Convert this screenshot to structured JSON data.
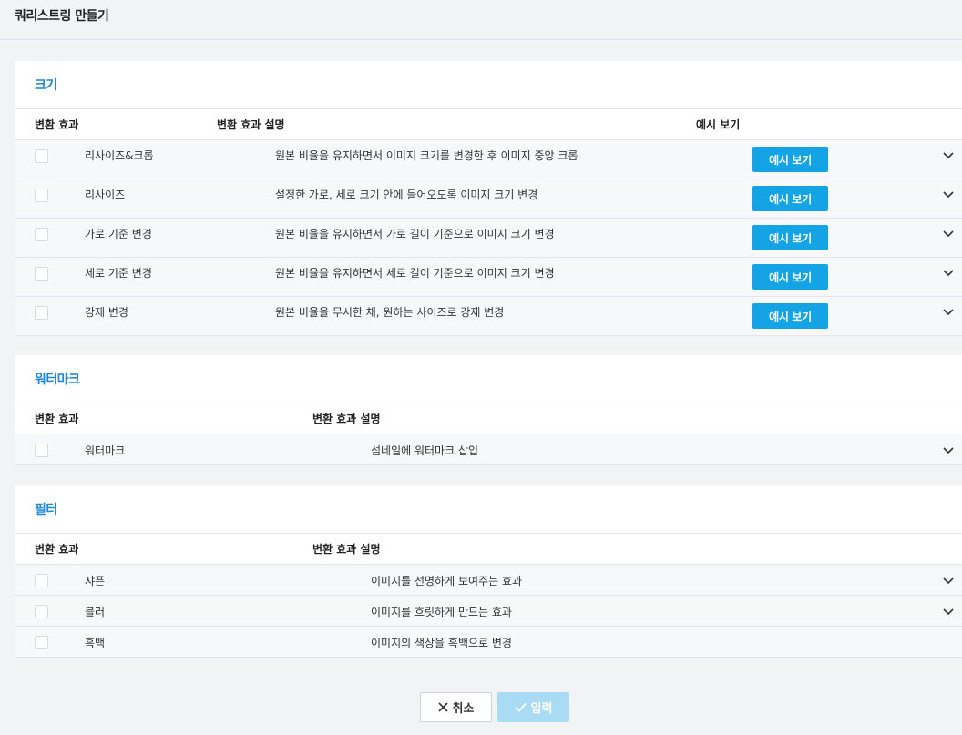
{
  "page": {
    "title": "쿼리스트링 만들기"
  },
  "size_section": {
    "title": "크기",
    "headers": {
      "effect": "변환 효과",
      "description": "변환 효과 설명",
      "preview": "예시 보기"
    },
    "rows": [
      {
        "name": "리사이즈&크롭",
        "description": "원본 비율을 유지하면서 이미지 크기를 변경한 후 이미지 중앙 크롭",
        "preview_label": "예시 보기"
      },
      {
        "name": "리사이즈",
        "description": "설정한 가로, 세로 크기 안에 들어오도록 이미지 크기 변경",
        "preview_label": "예시 보기"
      },
      {
        "name": "가로 기준 변경",
        "description": "원본 비율을 유지하면서 가로 길이 기준으로 이미지 크기 변경",
        "preview_label": "예시 보기"
      },
      {
        "name": "세로 기준 변경",
        "description": "원본 비율을 유지하면서 세로 길이 기준으로 이미지 크기 변경",
        "preview_label": "예시 보기"
      },
      {
        "name": "강제 변경",
        "description": "원본 비율을 무시한 채, 원하는 사이즈로 강제 변경",
        "preview_label": "예시 보기"
      }
    ]
  },
  "watermark_section": {
    "title": "워터마크",
    "headers": {
      "effect": "변환 효과",
      "description": "변환 효과 설명"
    },
    "rows": [
      {
        "name": "워터마크",
        "description": "섬네일에 워터마크 삽입"
      }
    ]
  },
  "filter_section": {
    "title": "필터",
    "headers": {
      "effect": "변환 효과",
      "description": "변환 효과 설명"
    },
    "rows": [
      {
        "name": "샤픈",
        "description": "이미지를 선명하게 보여주는 효과"
      },
      {
        "name": "블러",
        "description": "이미지를 흐릿하게 만드는 효과"
      },
      {
        "name": "흑백",
        "description": "이미지의 색상을 흑백으로 변경"
      }
    ]
  },
  "footer": {
    "cancel_label": "취소",
    "submit_label": "입력"
  },
  "icons": {
    "expand": "chevron-down-icon",
    "cancel": "close-icon",
    "submit": "check-icon"
  },
  "colors": {
    "accent": "#1f86d6",
    "button": "#14a4e6",
    "button_disabled": "#a9dcf4",
    "background": "#f2f3f5"
  }
}
